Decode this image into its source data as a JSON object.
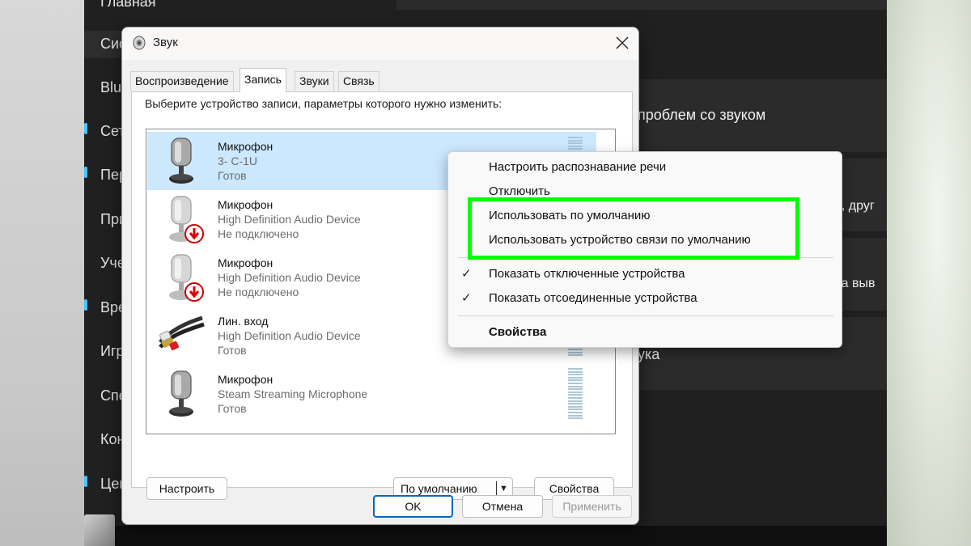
{
  "settings": {
    "nav": [
      "Главная",
      "Сис",
      "Blu",
      "Сет",
      "Пер",
      "При",
      "Уче",
      "Вре",
      "Игр",
      "Спе",
      "Кон",
      "Цен"
    ],
    "cards": {
      "troubleshoot": "проблем со звуком",
      "other_fragment": "ок, друг",
      "props_fragment": "тва выв",
      "bottom_fragment": "ука"
    }
  },
  "dialog": {
    "title": "Звук",
    "tabs": [
      "Воспроизведение",
      "Запись",
      "Звуки",
      "Связь"
    ],
    "active_tab": "Запись",
    "instruction": "Выберите устройство записи, параметры которого нужно изменить:",
    "devices": [
      {
        "name": "Микрофон",
        "device": "3- C-1U",
        "status": "Готов",
        "icon": "microphone-icon",
        "selected": true
      },
      {
        "name": "Микрофон",
        "device": "High Definition Audio Device",
        "status": "Не подключено",
        "icon": "microphone-disconnected-icon"
      },
      {
        "name": "Микрофон",
        "device": "High Definition Audio Device",
        "status": "Не подключено",
        "icon": "microphone-disconnected-icon"
      },
      {
        "name": "Лин. вход",
        "device": "High Definition Audio Device",
        "status": "Готов",
        "icon": "line-in-cable-icon"
      },
      {
        "name": "Микрофон",
        "device": "Steam Streaming Microphone",
        "status": "Готов",
        "icon": "microphone-icon"
      }
    ],
    "buttons": {
      "configure": "Настроить",
      "set_default": "По умолчанию",
      "properties": "Свойства",
      "ok": "OK",
      "cancel": "Отмена",
      "apply": "Применить"
    }
  },
  "context_menu": {
    "items": [
      {
        "label": "Настроить распознавание речи",
        "checked": false
      },
      {
        "label": "Отключить",
        "checked": false
      },
      {
        "label": "Использовать по умолчанию",
        "checked": false,
        "highlighted": true
      },
      {
        "label": "Использовать устройство связи по умолчанию",
        "checked": false,
        "highlighted": true
      },
      {
        "label": "Показать отключенные устройства",
        "checked": true
      },
      {
        "label": "Показать отсоединенные устройства",
        "checked": true
      },
      {
        "label": "Свойства",
        "checked": false,
        "bold": true
      }
    ],
    "highlight_color": "#00ff00"
  },
  "colors": {
    "selection": "#cce8ff",
    "accent": "#0067c0",
    "settings_bg": "#202020"
  }
}
